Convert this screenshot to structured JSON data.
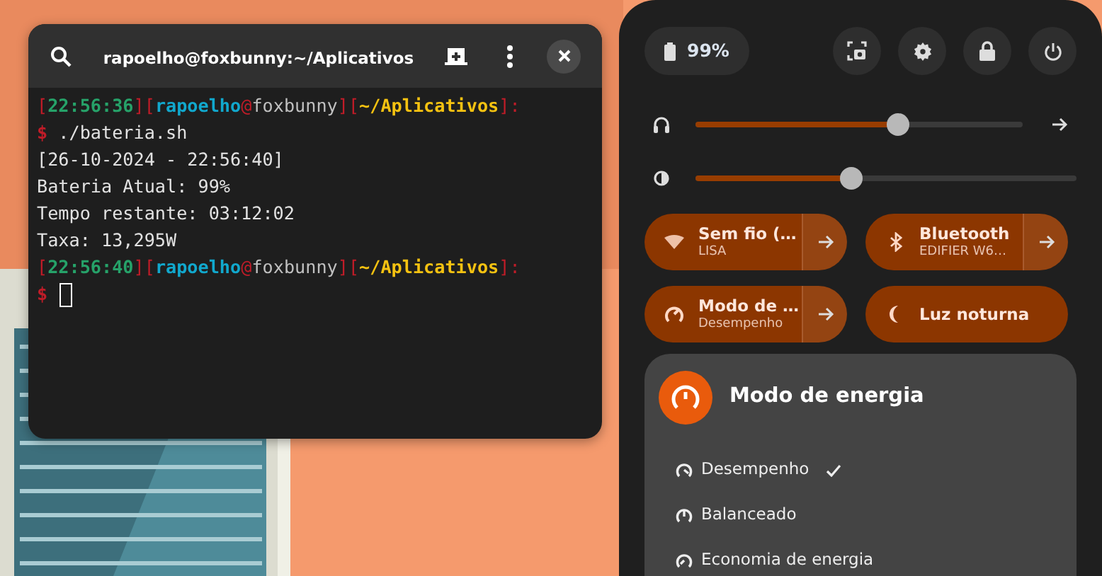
{
  "terminal": {
    "title": "rapoelho@foxbunny:~/Aplicativos",
    "lines": [
      {
        "segments": [
          {
            "kind": "bracket",
            "text": "["
          },
          {
            "kind": "time",
            "text": "22:56:36"
          },
          {
            "kind": "bracket",
            "text": "]["
          },
          {
            "kind": "user",
            "text": "rapoelho"
          },
          {
            "kind": "at",
            "text": "@"
          },
          {
            "kind": "host",
            "text": "foxbunny"
          },
          {
            "kind": "bracket",
            "text": "]["
          },
          {
            "kind": "path",
            "text": "~/Aplicativos"
          },
          {
            "kind": "bracket",
            "text": "]:"
          }
        ]
      },
      {
        "segments": [
          {
            "kind": "dollar",
            "text": "$"
          },
          {
            "kind": "plain",
            "text": " ./bateria.sh"
          }
        ]
      },
      {
        "segments": [
          {
            "kind": "plain",
            "text": "[26-10-2024 - 22:56:40]"
          }
        ]
      },
      {
        "segments": [
          {
            "kind": "plain",
            "text": "Bateria Atual: 99%"
          }
        ]
      },
      {
        "segments": [
          {
            "kind": "plain",
            "text": "Tempo restante: 03:12:02"
          }
        ]
      },
      {
        "segments": [
          {
            "kind": "plain",
            "text": "Taxa: 13,295W"
          }
        ]
      },
      {
        "segments": [
          {
            "kind": "bracket",
            "text": "["
          },
          {
            "kind": "time",
            "text": "22:56:40"
          },
          {
            "kind": "bracket",
            "text": "]["
          },
          {
            "kind": "user",
            "text": "rapoelho"
          },
          {
            "kind": "at",
            "text": "@"
          },
          {
            "kind": "host",
            "text": "foxbunny"
          },
          {
            "kind": "bracket",
            "text": "]["
          },
          {
            "kind": "path",
            "text": "~/Aplicativos"
          },
          {
            "kind": "bracket",
            "text": "]:"
          }
        ]
      },
      {
        "cursor": true,
        "segments": [
          {
            "kind": "dollar",
            "text": "$"
          }
        ]
      }
    ]
  },
  "quick_settings": {
    "battery": "99%",
    "sliders": [
      {
        "kind": "volume",
        "level": 0.62,
        "arrow": true
      },
      {
        "kind": "brightness",
        "level": 0.41,
        "arrow": false
      }
    ],
    "toggles": [
      {
        "kind": "wifi",
        "title": "Sem fio (…",
        "subtitle": "LISA",
        "on": true,
        "arrow": true
      },
      {
        "kind": "bluetooth",
        "title": "Bluetooth",
        "subtitle": "EDIFIER W6…",
        "on": true,
        "arrow": true
      },
      {
        "kind": "power",
        "title": "Modo de …",
        "subtitle": "Desempenho",
        "on": true,
        "arrow": true
      },
      {
        "kind": "night",
        "title": "Luz noturna",
        "on": true,
        "arrow": false
      }
    ],
    "menu": {
      "title": "Modo de energia",
      "items": [
        {
          "kind": "performance",
          "label": "Desempenho",
          "selected": true
        },
        {
          "kind": "balanced",
          "label": "Balanceado",
          "selected": false
        },
        {
          "kind": "saver",
          "label": "Economia de energia",
          "selected": false
        }
      ]
    }
  }
}
